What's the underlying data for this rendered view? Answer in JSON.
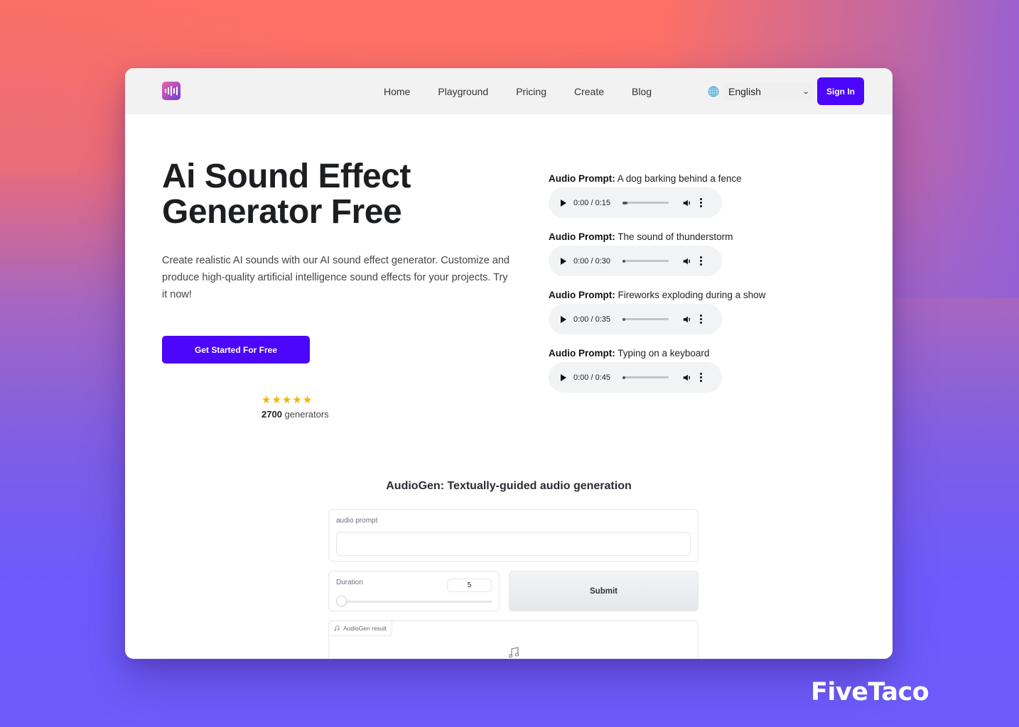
{
  "colors": {
    "accent": "#4b06fb",
    "star": "#f0b400",
    "player_bg": "#f1f3f4"
  },
  "nav": {
    "logo_icon": "sound-wave-icon",
    "links": [
      "Home",
      "Playground",
      "Pricing",
      "Create",
      "Blog"
    ],
    "language": {
      "icon": "globe-icon",
      "selected": "English"
    },
    "signin_label": "Sign In"
  },
  "hero": {
    "title_line1": "Ai Sound Effect",
    "title_line2": "Generator Free",
    "description": "Create realistic AI sounds with our AI sound effect generator. Customize and produce high-quality artificial intelligence sound effects for your projects. Try it now!",
    "cta_label": "Get Started For Free",
    "rating": {
      "stars": 5,
      "count": "2700",
      "count_suffix": " generators"
    }
  },
  "samples": [
    {
      "label": "Audio Prompt:",
      "prompt": " A dog barking behind a fence",
      "time": "0:00 / 0:15",
      "progress": 0.1
    },
    {
      "label": "Audio Prompt:",
      "prompt": " The sound of thunderstorm",
      "time": "0:00 / 0:30",
      "progress": 0.03
    },
    {
      "label": "Audio Prompt:",
      "prompt": " Fireworks exploding during a show",
      "time": "0:00 / 0:35",
      "progress": 0.03
    },
    {
      "label": "Audio Prompt:",
      "prompt": " Typing on a keyboard",
      "time": "0:00 / 0:45",
      "progress": 0.03
    }
  ],
  "audiogen": {
    "title": "AudioGen: Textually-guided audio generation",
    "prompt_label": "audio prompt",
    "prompt_value": "",
    "duration_label": "Duration",
    "duration_value": "5",
    "submit_label": "Submit",
    "result_label": "AudioGen result"
  },
  "watermark": "FiveTaco"
}
